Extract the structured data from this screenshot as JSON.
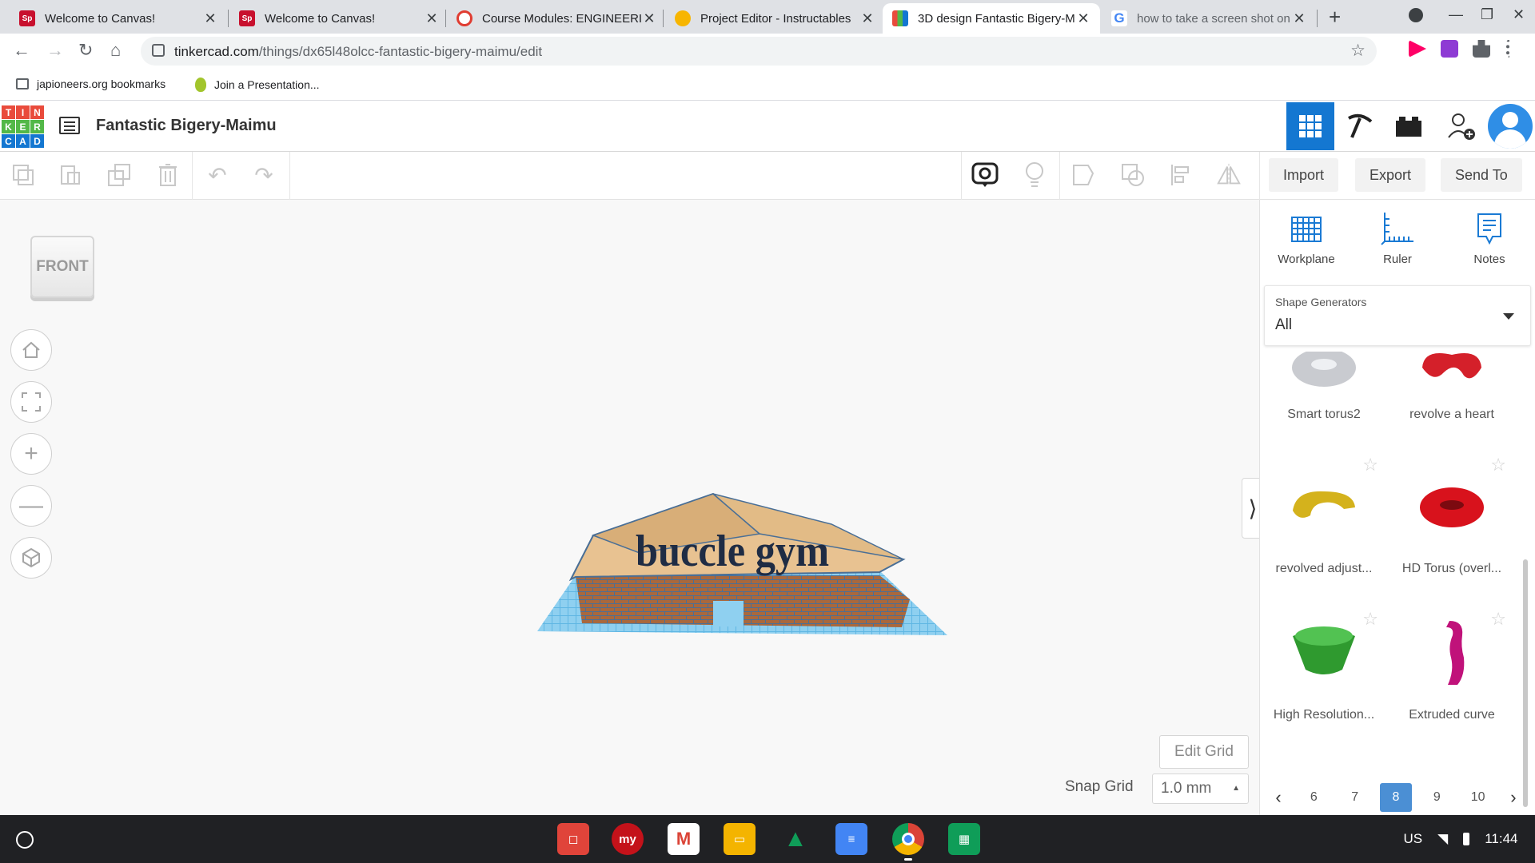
{
  "browser": {
    "tabs": [
      {
        "title": "Welcome to Canvas!",
        "favicon": "sp-icon",
        "color": "#c8102e"
      },
      {
        "title": "Welcome to Canvas!",
        "favicon": "sp-icon",
        "color": "#c8102e"
      },
      {
        "title": "Course Modules: ENGINEERI",
        "favicon": "canvas-icon",
        "color": "#e03c31"
      },
      {
        "title": "Project Editor - Instructables",
        "favicon": "instructables-icon",
        "color": "#f7b500"
      },
      {
        "title": "3D design Fantastic Bigery-M",
        "favicon": "tinkercad-icon",
        "color": "#1477d1"
      },
      {
        "title": "how to take a screen shot on",
        "favicon": "google-icon",
        "color": "#4285f4"
      }
    ],
    "url_host": "tinkercad.com",
    "url_path": "/things/dx65l48olcc-fantastic-bigery-maimu/edit",
    "bookmarks": [
      {
        "label": "japioneers.org bookmarks",
        "icon": "folder-icon"
      },
      {
        "label": "Join a Presentation...",
        "icon": "pear-deck-icon"
      }
    ]
  },
  "header": {
    "logo_letters": [
      "T",
      "I",
      "N",
      "K",
      "E",
      "R",
      "C",
      "A",
      "D"
    ],
    "design_title": "Fantastic Bigery-Maimu"
  },
  "toolbar": {
    "import_label": "Import",
    "export_label": "Export",
    "sendto_label": "Send To"
  },
  "workplane": {
    "viewcube_label": "FRONT",
    "model_text": "buccle gym",
    "edit_grid_label": "Edit Grid",
    "snap_grid_label": "Snap Grid",
    "snap_grid_value": "1.0 mm"
  },
  "panel": {
    "tools": [
      {
        "label": "Workplane",
        "icon": "workplane-icon"
      },
      {
        "label": "Ruler",
        "icon": "ruler-icon"
      },
      {
        "label": "Notes",
        "icon": "notes-icon"
      }
    ],
    "shape_generators_label": "Shape Generators",
    "shape_generators_value": "All",
    "shapes": [
      {
        "name": "Smart torus2",
        "color": "#c9cbd0"
      },
      {
        "name": "revolve a heart",
        "color": "#d4202a"
      },
      {
        "name": "revolved adjust...",
        "color": "#d4b21c"
      },
      {
        "name": "HD Torus (overl...",
        "color": "#d8121c"
      },
      {
        "name": "High Resolution...",
        "color": "#2f9a2f"
      },
      {
        "name": "Extruded curve",
        "color": "#c0127a"
      }
    ],
    "pages": [
      "6",
      "7",
      "8",
      "9",
      "10"
    ],
    "current_page": "8"
  },
  "shelf": {
    "apps": [
      {
        "name": "docs-quiz-icon",
        "color": "#e0443a",
        "glyph": "◻"
      },
      {
        "name": "my-app-icon",
        "color": "#c4121a",
        "glyph": "my"
      },
      {
        "name": "gmail-icon",
        "color": "#ffffff",
        "glyph": "M"
      },
      {
        "name": "slides-icon",
        "color": "#f4b400",
        "glyph": "▭"
      },
      {
        "name": "drive-icon",
        "color": "#0f9d58",
        "glyph": "▲"
      },
      {
        "name": "docs-icon",
        "color": "#4285f4",
        "glyph": "≡"
      },
      {
        "name": "chrome-icon",
        "color": "#db4437",
        "glyph": "◉"
      },
      {
        "name": "sheets-icon",
        "color": "#0f9d58",
        "glyph": "▦"
      }
    ],
    "keyboard": "US",
    "time": "11:44"
  }
}
